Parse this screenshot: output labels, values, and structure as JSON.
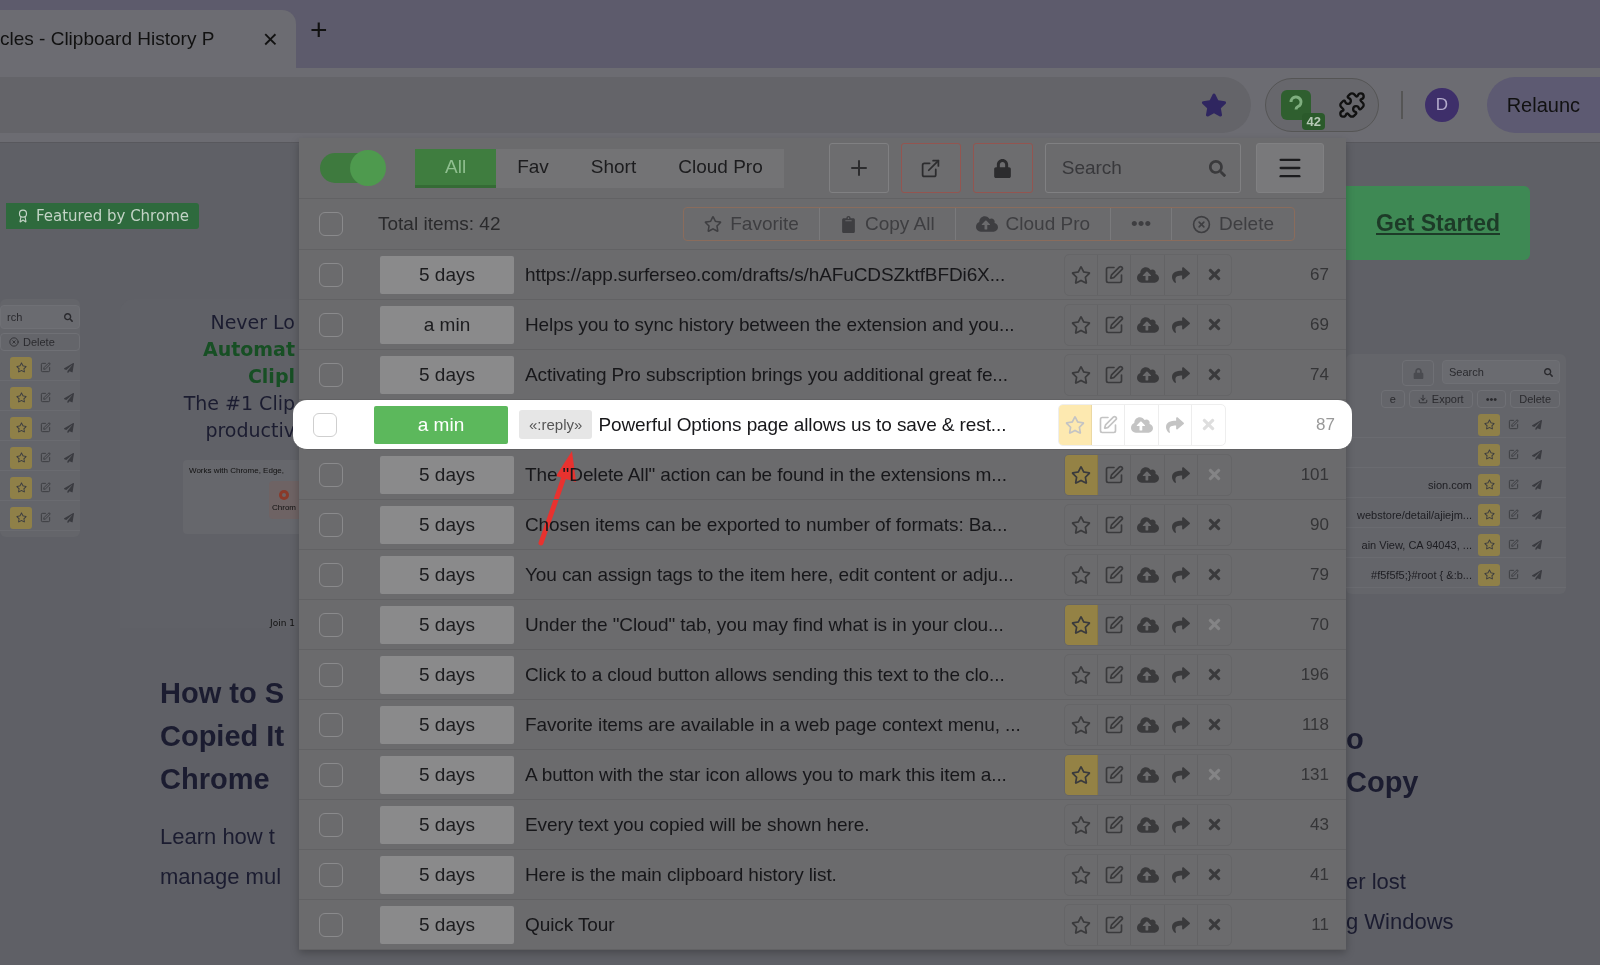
{
  "browser": {
    "tab": {
      "title": "cles - Clipboard History P",
      "close": "×"
    },
    "new_tab": "+",
    "extension_badge": "42",
    "avatar": "D",
    "relaunch": "Relaunc"
  },
  "page": {
    "featured_badge": "Featured by Chrome",
    "left_mini": {
      "search": "rch",
      "delete": "Delete",
      "rows": [
        {
          "favorite": true
        },
        {
          "favorite": true
        },
        {
          "favorite": true
        },
        {
          "favorite": true
        },
        {
          "favorite": true
        },
        {
          "favorite": true
        }
      ]
    },
    "hero_lines": [
      {
        "text": "Never Lo",
        "kind": "dark"
      },
      {
        "text": "Automat",
        "kind": "green"
      },
      {
        "text": "Clipl",
        "kind": "green"
      },
      {
        "text": "The #1 Clip",
        "kind": "dark"
      },
      {
        "text": "productiv",
        "kind": "dark"
      }
    ],
    "works_with": "Works with Chrome, Edge,",
    "browser_label": "Chrom",
    "join": "Join 1",
    "left_heading": [
      "How to S",
      "Copied It",
      "Chrome"
    ],
    "left_body": [
      "Learn how t",
      "manage mul"
    ],
    "get_started": "Get Started",
    "right_mini": {
      "search": "Search",
      "actions": [
        "e",
        "Export",
        "•••",
        "Delete"
      ],
      "rows": [
        {
          "text": "",
          "favorite": true
        },
        {
          "text": "",
          "favorite": true
        },
        {
          "text": "sion.com",
          "favorite": true
        },
        {
          "text": "webstore/detail/ajiejm...",
          "favorite": true
        },
        {
          "text": "ain View, CA 94043, ...",
          "favorite": true
        },
        {
          "text": "#f5f5f5;}#root { &:b...",
          "favorite": true
        }
      ]
    },
    "right_heading": [
      "o",
      "Copy"
    ],
    "right_body": [
      "er lost",
      "g Windows"
    ]
  },
  "popup": {
    "toggle_on": true,
    "tabs": [
      {
        "label": "All",
        "selected": true
      },
      {
        "label": "Fav",
        "selected": false
      },
      {
        "label": "Short",
        "selected": false
      },
      {
        "label": "Cloud Pro",
        "selected": false
      }
    ],
    "search": {
      "placeholder": "Search"
    },
    "select_all_checked": false,
    "total": "Total items: 42",
    "bulk_actions": [
      {
        "label": "Favorite",
        "kind": "star"
      },
      {
        "label": "Copy All",
        "kind": "clipboard"
      },
      {
        "label": "Cloud Pro",
        "kind": "cloud"
      },
      {
        "label": "•••",
        "kind": "more"
      },
      {
        "label": "Delete",
        "kind": "delete"
      }
    ],
    "items": [
      {
        "time": "5 days",
        "text": "https://app.surferseo.com/drafts/s/hAFuCDSZktfBFDi6X...",
        "count": "67",
        "favorite": false,
        "checked": false,
        "highlighted": false
      },
      {
        "time": "a min",
        "text": "Helps you to sync history between the extension and you...",
        "count": "69",
        "favorite": false,
        "checked": false,
        "highlighted": false
      },
      {
        "time": "5 days",
        "text": "Activating Pro subscription brings you additional great fe...",
        "count": "74",
        "favorite": false,
        "checked": false,
        "highlighted": false
      },
      {
        "time": "a min",
        "tag": "«:reply»",
        "text": "Powerful Options page allows us to save & rest...",
        "count": "87",
        "favorite": true,
        "checked": false,
        "highlighted": true
      },
      {
        "time": "5 days",
        "text": "The \"Delete All\" action can be found in the extensions m...",
        "count": "101",
        "favorite": true,
        "checked": false,
        "highlighted": false
      },
      {
        "time": "5 days",
        "text": "Chosen items can be exported to number of formats: Ba...",
        "count": "90",
        "favorite": false,
        "checked": false,
        "highlighted": false
      },
      {
        "time": "5 days",
        "text": "You can assign tags to the item here, edit content or adju...",
        "count": "79",
        "favorite": false,
        "checked": false,
        "highlighted": false
      },
      {
        "time": "5 days",
        "text": "Under the \"Cloud\" tab, you may find what is in your clou...",
        "count": "70",
        "favorite": true,
        "checked": false,
        "highlighted": false
      },
      {
        "time": "5 days",
        "text": "Click to a cloud button allows sending this text to the clo...",
        "count": "196",
        "favorite": false,
        "checked": false,
        "highlighted": false
      },
      {
        "time": "5 days",
        "text": "Favorite items are available in a web page context menu, ...",
        "count": "118",
        "favorite": false,
        "checked": false,
        "highlighted": false
      },
      {
        "time": "5 days",
        "text": "A button with the star icon allows you to mark this item a...",
        "count": "131",
        "favorite": true,
        "checked": false,
        "highlighted": false
      },
      {
        "time": "5 days",
        "text": "Every text you copied will be shown here.",
        "count": "43",
        "favorite": false,
        "checked": false,
        "highlighted": false
      },
      {
        "time": "5 days",
        "text": "Here is the main clipboard history list.",
        "count": "41",
        "favorite": false,
        "checked": false,
        "highlighted": false
      },
      {
        "time": "5 days",
        "text": "Quick Tour",
        "count": "11",
        "favorite": false,
        "checked": false,
        "highlighted": false
      }
    ]
  }
}
